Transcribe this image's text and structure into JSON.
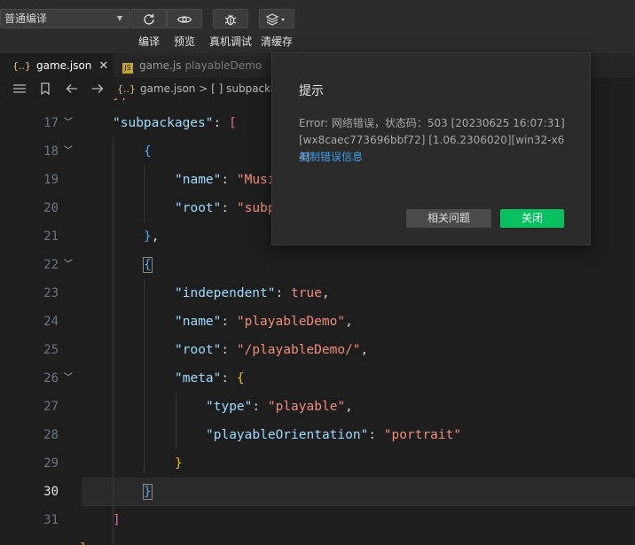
{
  "toolbar": {
    "mode_select": "普通编译",
    "buttons": [
      {
        "label": "编译",
        "icon": "refresh-icon"
      },
      {
        "label": "预览",
        "icon": "eye-icon"
      },
      {
        "label": "真机调试",
        "icon": "bug-icon"
      },
      {
        "label": "清缓存",
        "icon": "layers-icon"
      }
    ]
  },
  "tabs": [
    {
      "icon": "{..}",
      "name": "game.json",
      "active": true
    },
    {
      "icon": "JS",
      "name": "game.js",
      "sub": "playableDemo",
      "active": false
    }
  ],
  "breadcrumb": {
    "file": "game.json",
    "sep": ">",
    "item": "[ ] subpacka"
  },
  "editor": {
    "current_line": 30,
    "lines": [
      {
        "n": 17
      },
      {
        "n": 18
      },
      {
        "n": 19
      },
      {
        "n": 20
      },
      {
        "n": 21
      },
      {
        "n": 22
      },
      {
        "n": 23
      },
      {
        "n": 24
      },
      {
        "n": 25
      },
      {
        "n": 26
      },
      {
        "n": 27
      },
      {
        "n": 28
      },
      {
        "n": 29
      },
      {
        "n": 30
      },
      {
        "n": 31
      }
    ],
    "tokens": {
      "subpackages_key": "\"subpackages\"",
      "name_key": "\"name\"",
      "name_val_partial": "\"Musi",
      "root_key": "\"root\"",
      "root_val_partial": "\"subp",
      "independent_key": "\"independent\"",
      "true_val": "true",
      "name_val": "\"playableDemo\"",
      "root_val": "\"/playableDemo/\"",
      "meta_key": "\"meta\"",
      "type_key": "\"type\"",
      "type_val": "\"playable\"",
      "orient_key": "\"playableOrientation\"",
      "orient_val": "\"portrait\""
    }
  },
  "dialog": {
    "title": "提示",
    "message": "Error: 网络错误，状态码：503 [20230625 16:07:31][wx8caec773696bbf72] [1.06.2306020][win32-x64]",
    "link": "复制错误信息",
    "related_button": "相关问题",
    "close_button": "关闭"
  },
  "colors": {
    "accent_green": "#07c160",
    "link_blue": "#3d9be9"
  }
}
